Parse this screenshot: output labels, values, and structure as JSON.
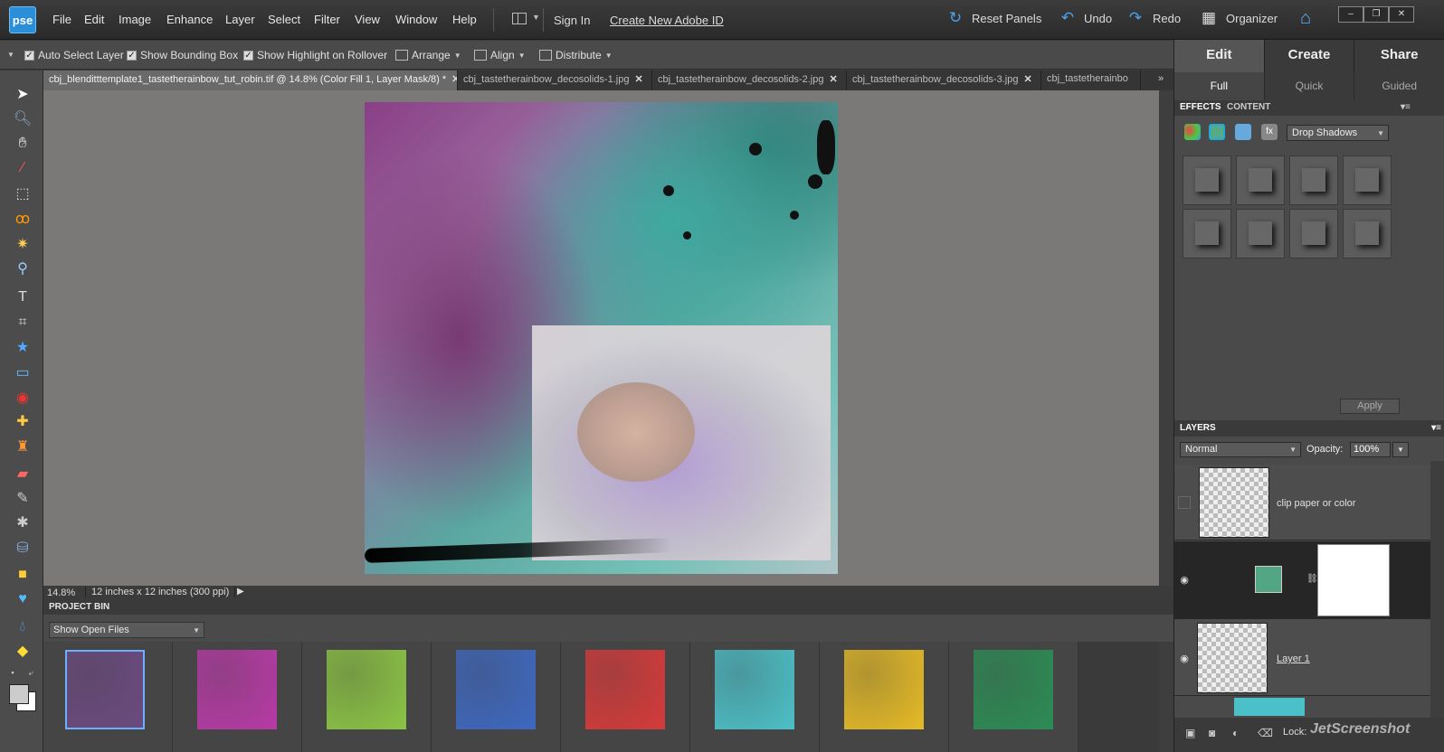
{
  "app": {
    "logo": "pse"
  },
  "menu": [
    "File",
    "Edit",
    "Image",
    "Enhance",
    "Layer",
    "Select",
    "Filter",
    "View",
    "Window",
    "Help"
  ],
  "top": {
    "sign_in": "Sign In",
    "create_id": "Create New Adobe ID",
    "reset": "Reset Panels",
    "undo": "Undo",
    "redo": "Redo",
    "organizer": "Organizer"
  },
  "options": {
    "auto_select": "Auto Select Layer",
    "bounding": "Show Bounding Box",
    "highlight": "Show Highlight on Rollover",
    "arrange": "Arrange",
    "align": "Align",
    "distribute": "Distribute"
  },
  "tabs": [
    "cbj_blenditttemplate1_tastetherainbow_tut_robin.tif @ 14.8% (Color Fill 1, Layer Mask/8) *",
    "cbj_tastetherainbow_decosolids-1.jpg",
    "cbj_tastetherainbow_decosolids-2.jpg",
    "cbj_tastetherainbow_decosolids-3.jpg",
    "cbj_tastetherainbo"
  ],
  "status": {
    "zoom": "14.8%",
    "doc": "12 inches x 12 inches (300 ppi)"
  },
  "project_bin": {
    "title": "PROJECT BIN",
    "select": "Show Open Files",
    "thumbs": [
      "#6b4a7f",
      "#b83aa6",
      "#8cc444",
      "#3e68c0",
      "#d63a3a",
      "#4cc0c8",
      "#e6bb26",
      "#2c8c55"
    ]
  },
  "panel": {
    "modes": [
      "Edit",
      "Create",
      "Share"
    ],
    "sub": [
      "Full",
      "Quick",
      "Guided"
    ],
    "efx_tab": "EFFECTS",
    "content_tab": "CONTENT",
    "category": "Drop Shadows",
    "apply": "Apply"
  },
  "layers": {
    "title": "LAYERS",
    "blend": "Normal",
    "opacity_label": "Opacity:",
    "opacity": "100%",
    "items": [
      {
        "name": "clip paper or color"
      },
      {
        "name": ""
      },
      {
        "name": "Layer 1"
      }
    ],
    "lock": "Lock:"
  },
  "watermark": "JetScreenshot"
}
